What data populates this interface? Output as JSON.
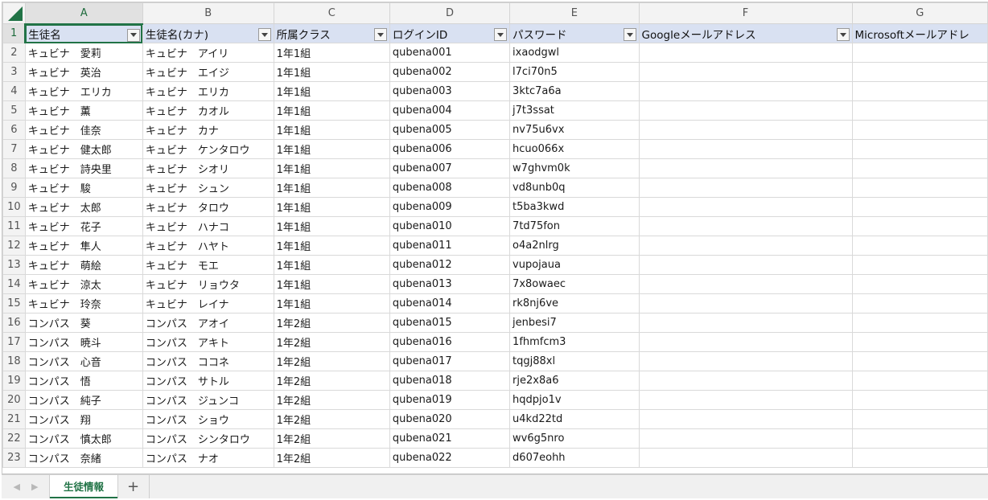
{
  "columns": [
    "A",
    "B",
    "C",
    "D",
    "E",
    "F",
    "G"
  ],
  "header": [
    "生徒名",
    "生徒名(カナ)",
    "所属クラス",
    "ログインID",
    "パスワード",
    "Googleメールアドレス",
    "Microsoftメールアドレ"
  ],
  "rows": [
    {
      "num": "2",
      "cells": [
        "キュビナ　愛莉",
        "キュビナ　アイリ",
        "1年1組",
        "qubena001",
        "ixaodgwl",
        "",
        ""
      ]
    },
    {
      "num": "3",
      "cells": [
        "キュビナ　英治",
        "キュビナ　エイジ",
        "1年1組",
        "qubena002",
        "l7ci70n5",
        "",
        ""
      ]
    },
    {
      "num": "4",
      "cells": [
        "キュビナ　エリカ",
        "キュビナ　エリカ",
        "1年1組",
        "qubena003",
        "3ktc7a6a",
        "",
        ""
      ]
    },
    {
      "num": "5",
      "cells": [
        "キュビナ　薫",
        "キュビナ　カオル",
        "1年1組",
        "qubena004",
        "j7t3ssat",
        "",
        ""
      ]
    },
    {
      "num": "6",
      "cells": [
        "キュビナ　佳奈",
        "キュビナ　カナ",
        "1年1組",
        "qubena005",
        "nv75u6vx",
        "",
        ""
      ]
    },
    {
      "num": "7",
      "cells": [
        "キュビナ　健太郎",
        "キュビナ　ケンタロウ",
        "1年1組",
        "qubena006",
        "hcuo066x",
        "",
        ""
      ]
    },
    {
      "num": "8",
      "cells": [
        "キュビナ　詩央里",
        "キュビナ　シオリ",
        "1年1組",
        "qubena007",
        "w7ghvm0k",
        "",
        ""
      ]
    },
    {
      "num": "9",
      "cells": [
        "キュビナ　駿",
        "キュビナ　シュン",
        "1年1組",
        "qubena008",
        "vd8unb0q",
        "",
        ""
      ]
    },
    {
      "num": "10",
      "cells": [
        "キュビナ　太郎",
        "キュビナ　タロウ",
        "1年1組",
        "qubena009",
        "t5ba3kwd",
        "",
        ""
      ]
    },
    {
      "num": "11",
      "cells": [
        "キュビナ　花子",
        "キュビナ　ハナコ",
        "1年1組",
        "qubena010",
        "7td75fon",
        "",
        ""
      ]
    },
    {
      "num": "12",
      "cells": [
        "キュビナ　隼人",
        "キュビナ　ハヤト",
        "1年1組",
        "qubena011",
        "o4a2nlrg",
        "",
        ""
      ]
    },
    {
      "num": "13",
      "cells": [
        "キュビナ　萌絵",
        "キュビナ　モエ",
        "1年1組",
        "qubena012",
        "vupojaua",
        "",
        ""
      ]
    },
    {
      "num": "14",
      "cells": [
        "キュビナ　涼太",
        "キュビナ　リョウタ",
        "1年1組",
        "qubena013",
        "7x8owaec",
        "",
        ""
      ]
    },
    {
      "num": "15",
      "cells": [
        "キュビナ　玲奈",
        "キュビナ　レイナ",
        "1年1組",
        "qubena014",
        "rk8nj6ve",
        "",
        ""
      ]
    },
    {
      "num": "16",
      "cells": [
        "コンパス　葵",
        "コンパス　アオイ",
        "1年2組",
        "qubena015",
        "jenbesi7",
        "",
        ""
      ]
    },
    {
      "num": "17",
      "cells": [
        "コンパス　暁斗",
        "コンパス　アキト",
        "1年2組",
        "qubena016",
        "1fhmfcm3",
        "",
        ""
      ]
    },
    {
      "num": "18",
      "cells": [
        "コンパス　心音",
        "コンパス　ココネ",
        "1年2組",
        "qubena017",
        "tqgj88xl",
        "",
        ""
      ]
    },
    {
      "num": "19",
      "cells": [
        "コンパス　悟",
        "コンパス　サトル",
        "1年2組",
        "qubena018",
        "rje2x8a6",
        "",
        ""
      ]
    },
    {
      "num": "20",
      "cells": [
        "コンパス　純子",
        "コンパス　ジュンコ",
        "1年2組",
        "qubena019",
        "hqdpjo1v",
        "",
        ""
      ]
    },
    {
      "num": "21",
      "cells": [
        "コンパス　翔",
        "コンパス　ショウ",
        "1年2組",
        "qubena020",
        "u4kd22td",
        "",
        ""
      ]
    },
    {
      "num": "22",
      "cells": [
        "コンパス　慎太郎",
        "コンパス　シンタロウ",
        "1年2組",
        "qubena021",
        "wv6g5nro",
        "",
        ""
      ]
    },
    {
      "num": "23",
      "cells": [
        "コンパス　奈緒",
        "コンパス　ナオ",
        "1年2組",
        "qubena022",
        "d607eohh",
        "",
        ""
      ]
    }
  ],
  "sheet_tab": "生徒情報",
  "add_sheet": "+",
  "nav_prev": "◀",
  "nav_next": "▶",
  "header_row_num": "1",
  "accent_color": "#217346",
  "header_fill": "#d9e1f2"
}
